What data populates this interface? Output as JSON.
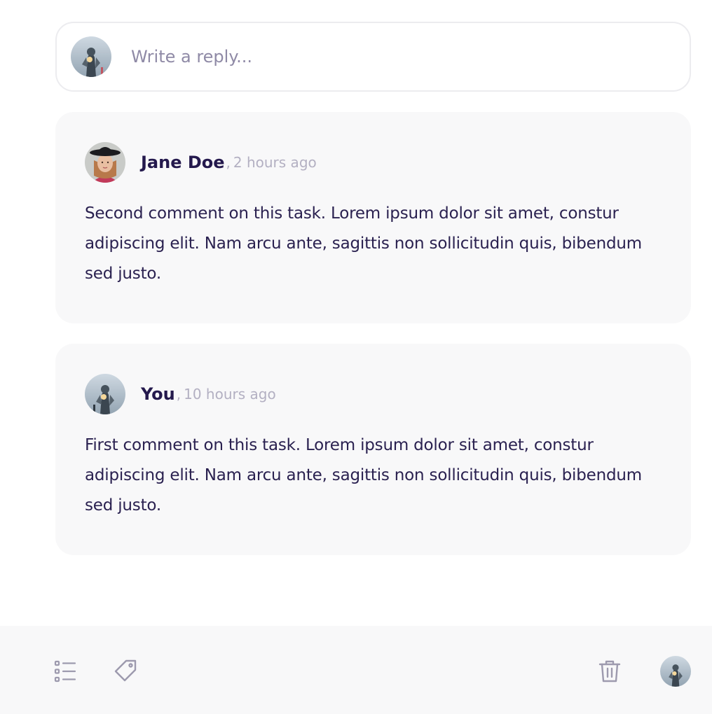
{
  "reply": {
    "placeholder": "Write a reply..."
  },
  "comments": [
    {
      "author": "Jane Doe",
      "separator": ",",
      "time": "2 hours ago",
      "body": "Second comment on this task. Lorem ipsum dolor sit amet, constur adipiscing elit. Nam arcu ante, sagittis non sollicitudin quis, bibendum sed justo.",
      "avatar": "woman-with-hat-avatar"
    },
    {
      "author": "You",
      "separator": ",",
      "time": "10 hours ago",
      "body": "First comment on this task. Lorem ipsum dolor sit amet, constur adipiscing elit. Nam arcu ante, sagittis non sollicitudin quis, bibendum sed justo.",
      "avatar": "armored-figure-avatar"
    }
  ],
  "toolbar": {
    "left_icons": [
      "checklist-icon",
      "tag-icon"
    ],
    "right_icons": [
      "trash-icon",
      "user-avatar"
    ]
  },
  "colors": {
    "text_primary": "#24194d",
    "text_muted": "#b3b0c2",
    "placeholder": "#8f8aa6",
    "card_bg": "#f8f8f9",
    "border": "#ececef",
    "icon": "#9d9aae"
  }
}
